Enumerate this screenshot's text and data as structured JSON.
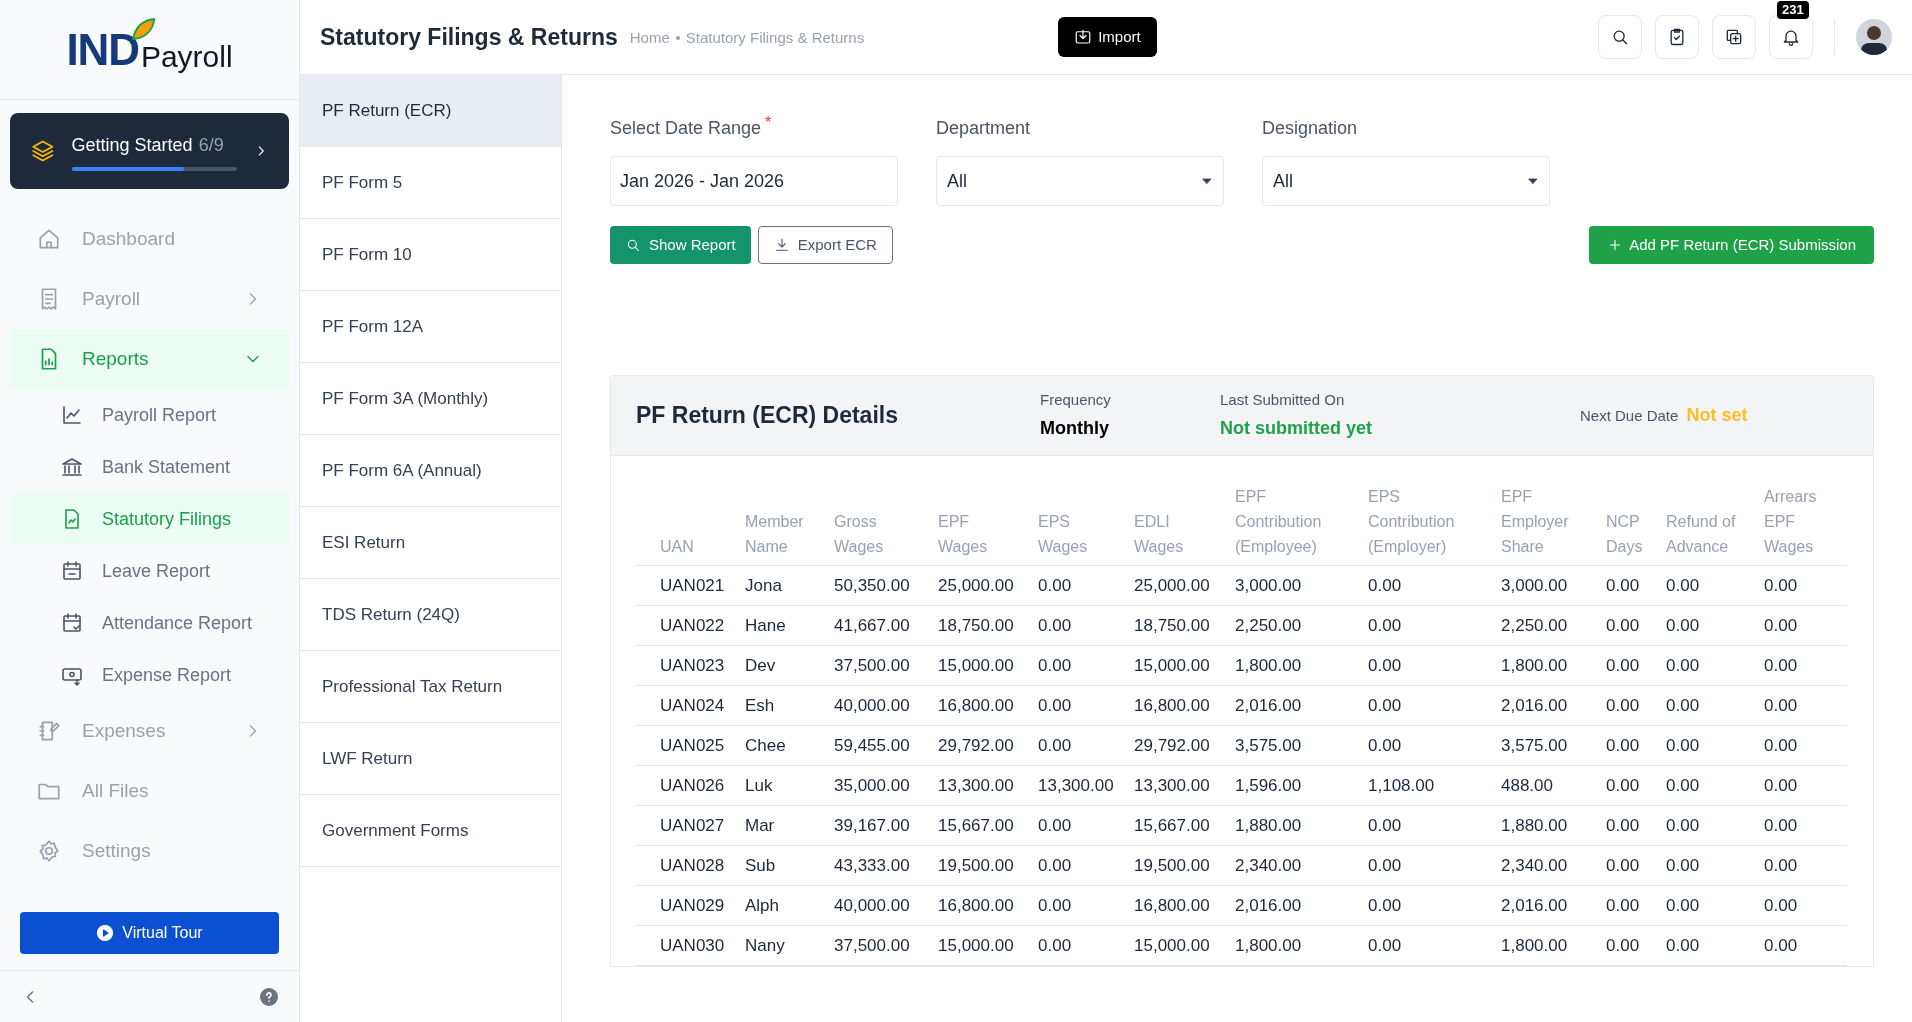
{
  "app": {
    "logo_mark": "IND",
    "logo_text": "Payroll"
  },
  "getting_started": {
    "label": "Getting Started",
    "progress": "6/9",
    "level": 0.68
  },
  "nav": [
    {
      "label": "Dashboard",
      "selected": false
    },
    {
      "label": "Payroll",
      "selected": false,
      "expanded": false
    },
    {
      "label": "Reports",
      "selected": true,
      "expanded": true,
      "children": [
        {
          "label": "Payroll Report",
          "selected": false
        },
        {
          "label": "Bank Statement",
          "selected": false
        },
        {
          "label": "Statutory Filings",
          "selected": true
        },
        {
          "label": "Leave Report",
          "selected": false
        },
        {
          "label": "Attendance Report",
          "selected": false
        },
        {
          "label": "Expense Report",
          "selected": false
        }
      ]
    },
    {
      "label": "Expenses",
      "selected": false,
      "expanded": false
    },
    {
      "label": "All Files",
      "selected": false
    },
    {
      "label": "Settings",
      "selected": false
    }
  ],
  "virtual_tour": "Virtual Tour",
  "header": {
    "title": "Statutory Filings & Returns",
    "breadcrumb": [
      "Home",
      "Statutory Filings & Returns"
    ],
    "import_button": "Import",
    "notification_count": "231"
  },
  "filing_types": [
    {
      "label": "PF Return (ECR)",
      "selected": true
    },
    {
      "label": "PF Form 5",
      "selected": false
    },
    {
      "label": "PF Form 10",
      "selected": false
    },
    {
      "label": "PF Form 12A",
      "selected": false
    },
    {
      "label": "PF Form 3A (Monthly)",
      "selected": false
    },
    {
      "label": "PF Form 6A (Annual)",
      "selected": false
    },
    {
      "label": "ESI Return",
      "selected": false
    },
    {
      "label": "TDS Return (24Q)",
      "selected": false
    },
    {
      "label": "Professional Tax Return",
      "selected": false
    },
    {
      "label": "LWF Return",
      "selected": false
    },
    {
      "label": "Government Forms",
      "selected": false
    }
  ],
  "filters": [
    {
      "kind": "input",
      "label": "Select Date Range",
      "required_mark": "*",
      "value": "Jan 2026 - Jan 2026"
    },
    {
      "kind": "select",
      "label": "Department",
      "value": "All"
    },
    {
      "kind": "select",
      "label": "Designation",
      "value": "All"
    }
  ],
  "actions": {
    "show_report": "Show Report",
    "export": "Export ECR",
    "add": "Add PF Return (ECR) Submission"
  },
  "details": {
    "title": "PF Return (ECR) Details",
    "frequency_label": "Frequency",
    "frequency": "Monthly",
    "last_submitted_label": "Last Submitted On",
    "last_submitted": "Not submitted yet",
    "next_due_label": "Next Due Date",
    "next_due": "Not set"
  },
  "table": {
    "columns": [
      "UAN",
      "Member Name",
      "Gross Wages",
      "EPF Wages",
      "EPS Wages",
      "EDLI Wages",
      "EPF Contribution (Employee)",
      "EPS Contribution (Employer)",
      "EPF Employer Share",
      "NCP Days",
      "Refund of Advance",
      "Arrears EPF Wages"
    ],
    "rows": [
      [
        "UAN021",
        "Jona",
        "50,350.00",
        "25,000.00",
        "0.00",
        "25,000.00",
        "3,000.00",
        "0.00",
        "3,000.00",
        "0.00",
        "0.00",
        "0.00"
      ],
      [
        "UAN022",
        "Hane",
        "41,667.00",
        "18,750.00",
        "0.00",
        "18,750.00",
        "2,250.00",
        "0.00",
        "2,250.00",
        "0.00",
        "0.00",
        "0.00"
      ],
      [
        "UAN023",
        "Dev",
        "37,500.00",
        "15,000.00",
        "0.00",
        "15,000.00",
        "1,800.00",
        "0.00",
        "1,800.00",
        "0.00",
        "0.00",
        "0.00"
      ],
      [
        "UAN024",
        "Esh",
        "40,000.00",
        "16,800.00",
        "0.00",
        "16,800.00",
        "2,016.00",
        "0.00",
        "2,016.00",
        "0.00",
        "0.00",
        "0.00"
      ],
      [
        "UAN025",
        "Chee",
        "59,455.00",
        "29,792.00",
        "0.00",
        "29,792.00",
        "3,575.00",
        "0.00",
        "3,575.00",
        "0.00",
        "0.00",
        "0.00"
      ],
      [
        "UAN026",
        "Luk",
        "35,000.00",
        "13,300.00",
        "13,300.00",
        "13,300.00",
        "1,596.00",
        "1,108.00",
        "488.00",
        "0.00",
        "0.00",
        "0.00"
      ],
      [
        "UAN027",
        "Mar",
        "39,167.00",
        "15,667.00",
        "0.00",
        "15,667.00",
        "1,880.00",
        "0.00",
        "1,880.00",
        "0.00",
        "0.00",
        "0.00"
      ],
      [
        "UAN028",
        "Sub",
        "43,333.00",
        "19,500.00",
        "0.00",
        "19,500.00",
        "2,340.00",
        "0.00",
        "2,340.00",
        "0.00",
        "0.00",
        "0.00"
      ],
      [
        "UAN029",
        "Alph",
        "40,000.00",
        "16,800.00",
        "0.00",
        "16,800.00",
        "2,016.00",
        "0.00",
        "2,016.00",
        "0.00",
        "0.00",
        "0.00"
      ],
      [
        "UAN030",
        "Nany",
        "37,500.00",
        "15,000.00",
        "0.00",
        "15,000.00",
        "1,800.00",
        "0.00",
        "1,800.00",
        "0.00",
        "0.00",
        "0.00"
      ]
    ]
  }
}
